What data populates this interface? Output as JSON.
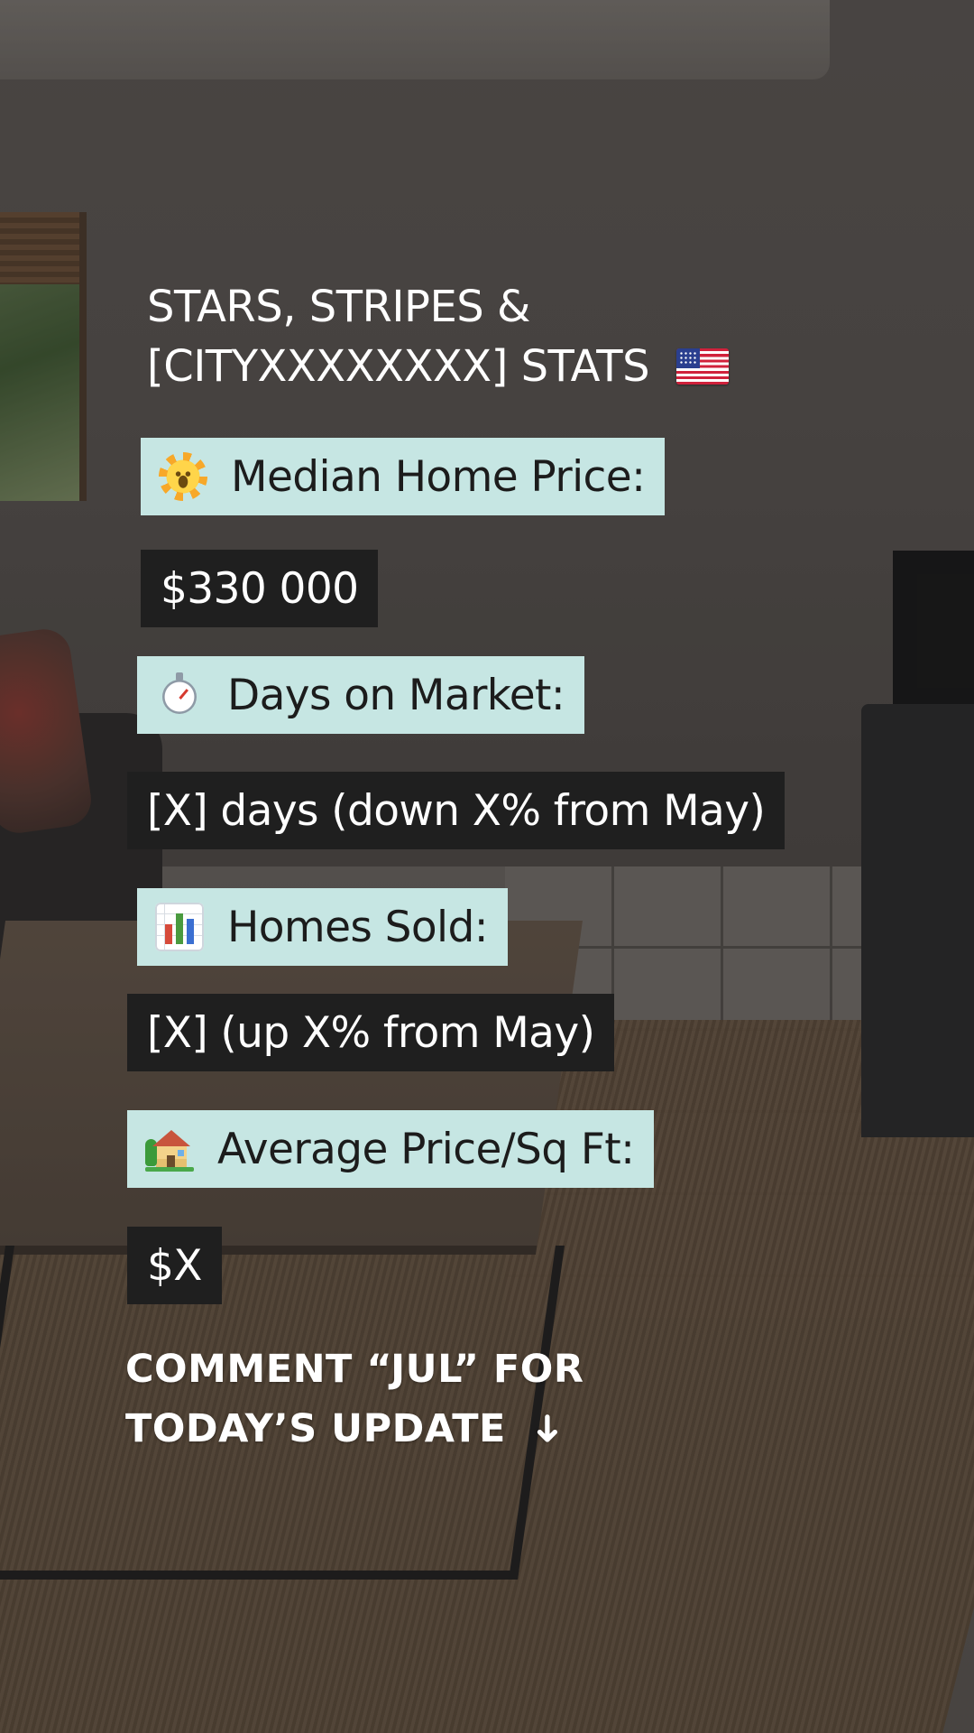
{
  "title": {
    "line1": "STARS, STRIPES &",
    "line2": "[CITYXXXXXXXX] STATS",
    "icon": "us-flag-icon"
  },
  "stats": [
    {
      "icon": "sun-with-face-icon",
      "label": "Median Home Price:",
      "value": "$330 000"
    },
    {
      "icon": "stopwatch-icon",
      "label": "Days on Market:",
      "value": "[X] days (down X% from  May)"
    },
    {
      "icon": "bar-chart-icon",
      "label": "Homes Sold:",
      "value": "[X] (up X% from May)"
    },
    {
      "icon": "house-with-garden-icon",
      "label": "Average Price/Sq Ft:",
      "value": "$X"
    }
  ],
  "cta": {
    "line1": "COMMENT “JUL” FOR",
    "line2": "TODAY’S UPDATE",
    "icon": "arrow-down-icon",
    "arrow": "➜"
  },
  "colors": {
    "label_bg": "#c6e6e3",
    "value_bg": "#1f1f1f",
    "text_light": "#ffffff",
    "text_dark": "#1c1c1c"
  }
}
